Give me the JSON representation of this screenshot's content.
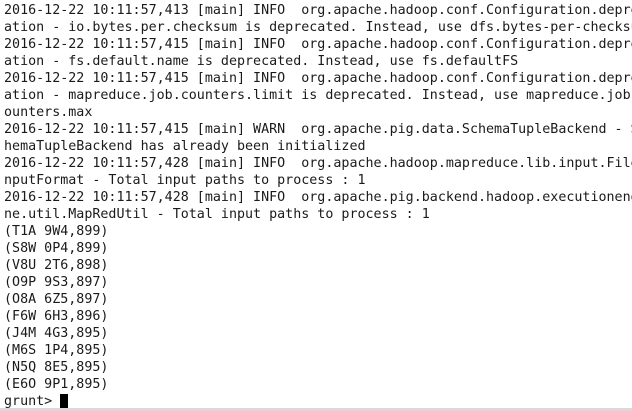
{
  "terminal": {
    "lines": [
      "2016-12-22 10:11:57,413 [main] INFO  org.apache.hadoop.conf.Configuration.depre",
      "ation - io.bytes.per.checksum is deprecated. Instead, use dfs.bytes-per-checksu",
      "2016-12-22 10:11:57,415 [main] INFO  org.apache.hadoop.conf.Configuration.depre",
      "ation - fs.default.name is deprecated. Instead, use fs.defaultFS",
      "2016-12-22 10:11:57,415 [main] INFO  org.apache.hadoop.conf.Configuration.depre",
      "ation - mapreduce.job.counters.limit is deprecated. Instead, use mapreduce.job.",
      "ounters.max",
      "2016-12-22 10:11:57,415 [main] WARN  org.apache.pig.data.SchemaTupleBackend - S",
      "hemaTupleBackend has already been initialized",
      "2016-12-22 10:11:57,428 [main] INFO  org.apache.hadoop.mapreduce.lib.input.File",
      "nputFormat - Total input paths to process : 1",
      "2016-12-22 10:11:57,428 [main] INFO  org.apache.pig.backend.hadoop.executioneng",
      "ne.util.MapRedUtil - Total input paths to process : 1",
      "(T1A 9W4,899)",
      "(S8W 0P4,899)",
      "(V8U 2T6,898)",
      "(O9P 9S3,897)",
      "(O8A 6Z5,897)",
      "(F6W 6H3,896)",
      "(J4M 4G3,895)",
      "(M6S 1P4,895)",
      "(N5Q 8E5,895)",
      "(E6O 9P1,895)"
    ],
    "prompt": "grunt> ",
    "colors": {
      "background": "#ffffff",
      "text": "#1a1a1a",
      "cursor": "#000000"
    }
  }
}
